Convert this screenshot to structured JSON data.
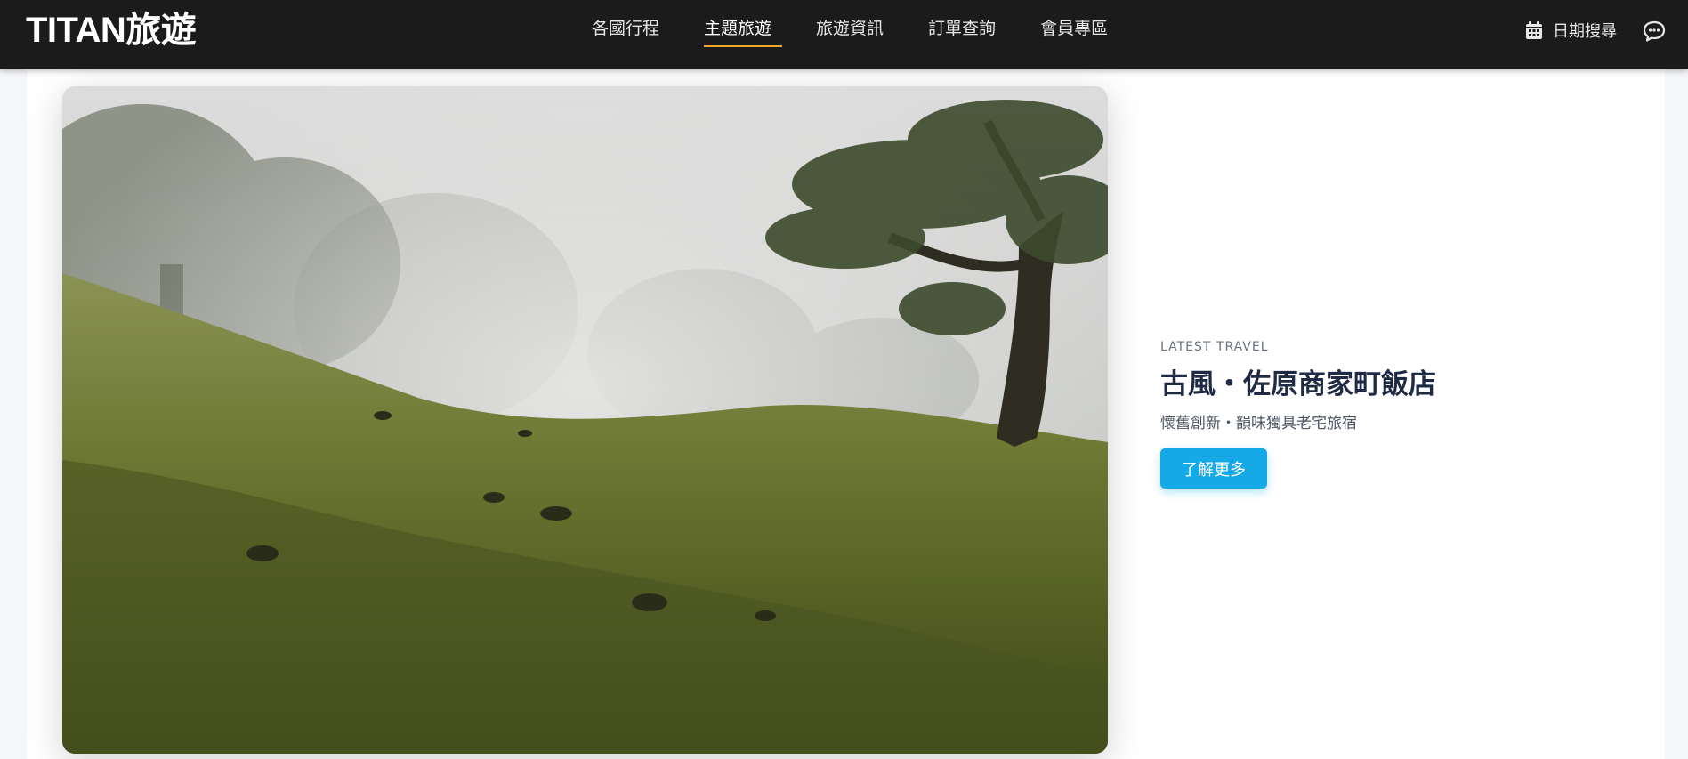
{
  "header": {
    "brand": "TITAN旅遊",
    "nav": [
      {
        "label": "各國行程",
        "active": false
      },
      {
        "label": "主題旅遊",
        "active": true
      },
      {
        "label": "旅遊資訊",
        "active": false
      },
      {
        "label": "訂單查詢",
        "active": false
      },
      {
        "label": "會員專區",
        "active": false
      }
    ],
    "date_search_label": "日期搜尋",
    "icons": {
      "date_search": "calendar-icon",
      "chat": "chat-bubble-icon"
    },
    "accent_color": "#f0a82c"
  },
  "feature": {
    "image": "misty-forest-hillside",
    "eyebrow": "LATEST TRAVEL",
    "title": "古風・佐原商家町飯店",
    "subtitle": "懷舊創新・韻味獨具老宅旅宿",
    "cta_label": "了解更多",
    "cta_color": "#16a9e8"
  }
}
